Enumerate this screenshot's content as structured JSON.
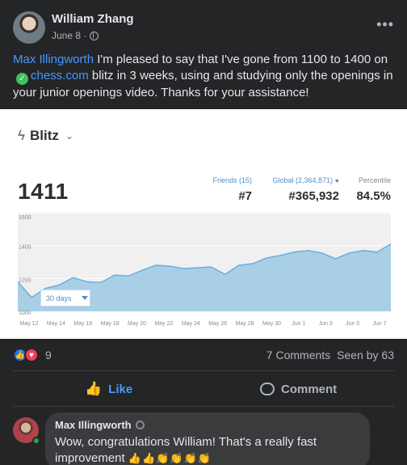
{
  "post": {
    "author": "William Zhang",
    "date": "June 8 ·",
    "more_label": "•••",
    "text_mention": "Max Illingworth",
    "text_part1": " I'm pleased to say that I've gone from 1100 to 1400 on",
    "verified_glyph": "✓",
    "text_link": "chess.com",
    "text_part2": " blitz in 3 weeks, using and studying only the openings in your junior openings video. Thanks for your assistance!"
  },
  "card": {
    "mode_label": "Blitz",
    "rating": "1411",
    "friends": {
      "label": "Friends (15)",
      "value": "#7"
    },
    "global": {
      "label": "Global (2,364,871)",
      "value": "#365,932"
    },
    "percentile": {
      "label": "Percentile",
      "value": "84.5%"
    },
    "range_label": "30 days"
  },
  "chart_data": {
    "type": "area",
    "x": [
      "May 12",
      "",
      "May 14",
      "",
      "May 16",
      "",
      "May 18",
      "",
      "May 20",
      "",
      "May 22",
      "",
      "May 24",
      "",
      "May 26",
      "",
      "May 28",
      "",
      "May 30",
      "",
      "Jun 1",
      "",
      "Jun 3",
      "",
      "Jun 5",
      "",
      "Jun 7",
      ""
    ],
    "tick_labels": [
      "May 12",
      "May 14",
      "May 16",
      "May 18",
      "May 20",
      "May 22",
      "May 24",
      "May 26",
      "May 28",
      "May 30",
      "Jun 1",
      "Jun 3",
      "Jun 5",
      "Jun 7"
    ],
    "y_ticks": [
      "1600",
      "1400",
      "1200",
      "1000"
    ],
    "values": [
      1180,
      1085,
      1140,
      1160,
      1205,
      1180,
      1175,
      1220,
      1215,
      1250,
      1280,
      1275,
      1260,
      1265,
      1270,
      1225,
      1280,
      1290,
      1325,
      1340,
      1360,
      1370,
      1355,
      1320,
      1355,
      1370,
      1360,
      1410
    ],
    "ylim": [
      1000,
      1600
    ],
    "grid": true,
    "colors": {
      "fill": "#a9cfe6",
      "line": "#6aaedb",
      "plot_bg": "#f0f0f0",
      "grid": "#ffffff"
    }
  },
  "engagement": {
    "reaction_count": "9",
    "comments": "7 Comments",
    "seen_by": "Seen by 63"
  },
  "actions": {
    "like_label": "Like",
    "comment_label": "Comment"
  },
  "comment": {
    "author": "Max Illingworth",
    "text": "Wow, congratulations William! That's a really fast improvement",
    "emojis": "👍👍👏👏👏👏"
  }
}
